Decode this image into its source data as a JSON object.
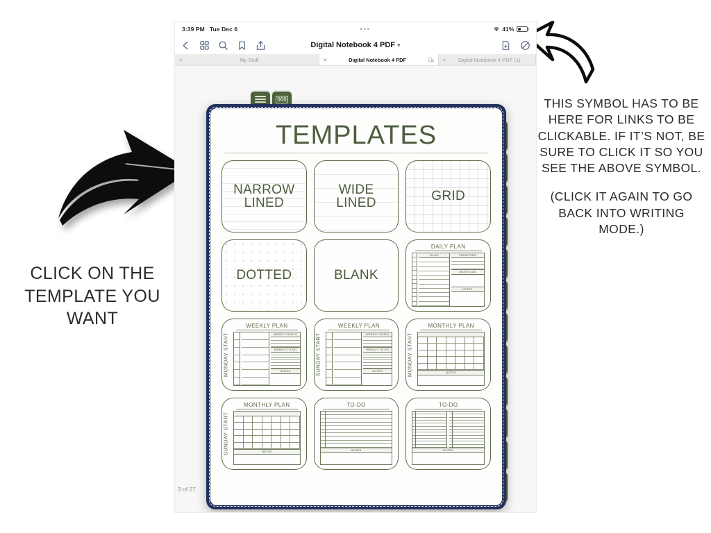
{
  "status_bar": {
    "time": "3:39 PM",
    "date": "Tue Dec 6",
    "center_dots": "•••",
    "battery_percent": "41%",
    "wifi_icon": "wifi-icon",
    "battery_icon": "battery-icon"
  },
  "toolbar": {
    "back_icon": "chevron-left-icon",
    "thumbnails_icon": "grid-view-icon",
    "search_icon": "search-icon",
    "bookmark_icon": "bookmark-icon",
    "share_icon": "share-icon",
    "document_title": "Digital Notebook 4 PDF",
    "title_chevron": "▾",
    "add_page_icon": "add-page-icon",
    "readonly_icon": "pencil-slash-icon"
  },
  "tabs": [
    {
      "label": "My Stuff",
      "active": false,
      "close_icon": "×"
    },
    {
      "label": "Digital Notebook 4 PDF",
      "active": true,
      "close_icon": "×",
      "split_icon": "split-view-icon"
    },
    {
      "label": "Digital Notebook 4 PDF (1)",
      "active": false,
      "close_icon": "×"
    }
  ],
  "document": {
    "page_indicator": "3 of 27",
    "notebook_title": "TEMPLATES",
    "cover_color": "#22305c",
    "tab_color": "#4c6339",
    "accent_green": "#4d5c3e",
    "top_tabs": [
      {
        "icon": "lines-tab-icon"
      },
      {
        "icon": "zeros-tab-icon",
        "label": "000"
      }
    ],
    "side_tab_count": 12,
    "templates": [
      {
        "id": "narrow-lined",
        "label": "NARROW\nLINED",
        "pattern": "narrow-lines",
        "style": "text"
      },
      {
        "id": "wide-lined",
        "label": "WIDE\nLINED",
        "pattern": "wide-lines",
        "style": "text"
      },
      {
        "id": "grid",
        "label": "GRID",
        "pattern": "grid",
        "style": "text"
      },
      {
        "id": "dotted",
        "label": "DOTTED",
        "pattern": "dots",
        "style": "text"
      },
      {
        "id": "blank",
        "label": "BLANK",
        "pattern": "blank",
        "style": "text"
      },
      {
        "id": "daily-plan",
        "label": "DAILY PLAN",
        "style": "preview",
        "sections": [
          "TO-DO",
          "PRIORITIES",
          "GRATITUDE",
          "NOTES"
        ]
      },
      {
        "id": "weekly-plan-monday",
        "label": "WEEKLY PLAN",
        "side_label": "MONDAY START",
        "style": "preview",
        "sections": [
          "WEEKLY GOALS",
          "WEEKLY TO-DO",
          "NOTES"
        ]
      },
      {
        "id": "weekly-plan-sunday",
        "label": "WEEKLY PLAN",
        "side_label": "SUNDAY START",
        "style": "preview",
        "sections": [
          "WEEKLY GOALS",
          "WEEKLY TO-DO",
          "NOTES"
        ]
      },
      {
        "id": "monthly-plan-monday",
        "label": "MONTHLY PLAN",
        "side_label": "MONDAY START",
        "style": "preview",
        "sections": [
          "NOTES"
        ]
      },
      {
        "id": "monthly-plan-sunday",
        "label": "MONTHLY PLAN",
        "side_label": "SUNDAY START",
        "style": "preview",
        "sections": [
          "NOTES"
        ]
      },
      {
        "id": "to-do-single",
        "label": "TO-DO",
        "style": "preview",
        "sections": [
          "NOTES"
        ]
      },
      {
        "id": "to-do-double",
        "label": "TO-DO",
        "style": "preview",
        "sections": [
          "NOTES"
        ]
      }
    ]
  },
  "annotations": {
    "left_text": "CLICK ON THE TEMPLATE YOU WANT",
    "right_text_1": "THIS SYMBOL HAS TO BE HERE FOR LINKS TO BE CLICKABLE. IF IT’S NOT, BE SURE TO CLICK IT SO YOU SEE THE ABOVE SYMBOL.",
    "right_text_2": "(CLICK IT AGAIN TO GO BACK INTO WRITING MODE.)",
    "left_arrow_icon": "curved-arrow-right-icon",
    "right_arrow_icon": "curved-arrow-up-left-icon"
  }
}
